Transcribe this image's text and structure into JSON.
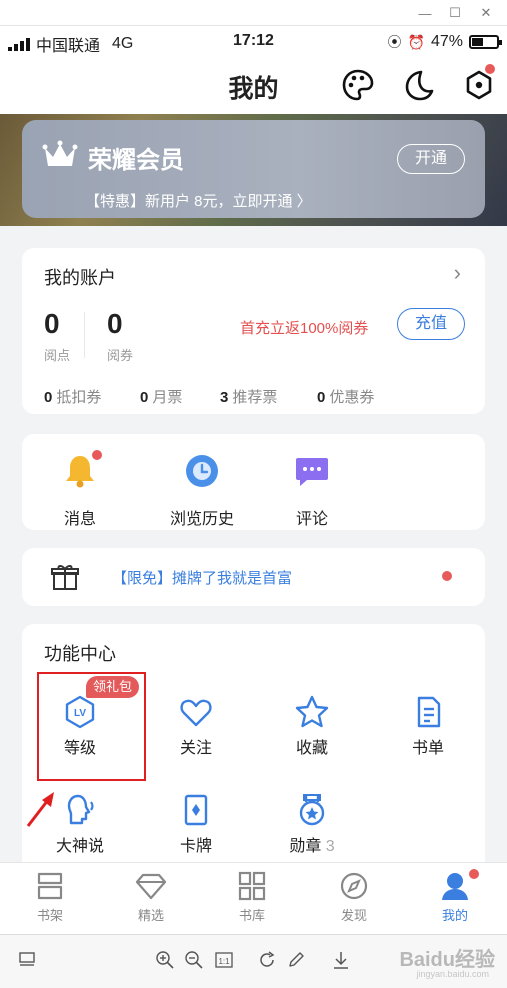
{
  "status_bar": {
    "carrier": "中国联通",
    "network": "4G",
    "time": "17:12",
    "battery": "47%"
  },
  "header": {
    "title": "我的",
    "icons": [
      "palette-icon",
      "moon-icon",
      "settings-hex-icon"
    ]
  },
  "vip": {
    "title": "荣耀会员",
    "subtitle": "【特惠】新用户 8元，立即开通 〉",
    "button": "开通"
  },
  "account": {
    "title": "我的账户",
    "chevron": "›",
    "balances": [
      {
        "value": "0",
        "label": "阅点"
      },
      {
        "value": "0",
        "label": "阅券"
      }
    ],
    "promo": "首充立返100%阅券",
    "recharge": "充值",
    "tickets": [
      {
        "count": "0",
        "label": "抵扣券"
      },
      {
        "count": "0",
        "label": "月票"
      },
      {
        "count": "3",
        "label": "推荐票"
      },
      {
        "count": "0",
        "label": "优惠券"
      }
    ]
  },
  "quick": [
    {
      "label": "消息"
    },
    {
      "label": "浏览历史"
    },
    {
      "label": "评论"
    }
  ],
  "promo_bar": {
    "text": "【限免】摊牌了我就是首富"
  },
  "features": {
    "title": "功能中心",
    "badge": "领礼包",
    "items": [
      {
        "label": "等级",
        "icon": "level-icon"
      },
      {
        "label": "关注",
        "icon": "heart-icon"
      },
      {
        "label": "收藏",
        "icon": "star-icon"
      },
      {
        "label": "书单",
        "icon": "booklist-icon"
      },
      {
        "label": "大神说",
        "icon": "speaker-head-icon"
      },
      {
        "label": "卡牌",
        "icon": "card-icon"
      },
      {
        "label": "勋章",
        "icon": "medal-icon",
        "count": "3"
      }
    ]
  },
  "tabs": [
    {
      "label": "书架"
    },
    {
      "label": "精选"
    },
    {
      "label": "书库"
    },
    {
      "label": "发现"
    },
    {
      "label": "我的",
      "active": true
    }
  ],
  "viewer": {
    "watermark": "Baidu经验",
    "watermark_sub": "jingyan.baidu.com"
  },
  "colors": {
    "accent": "#3a7fe0",
    "red": "#e45050",
    "highlight_box": "#e02020"
  }
}
